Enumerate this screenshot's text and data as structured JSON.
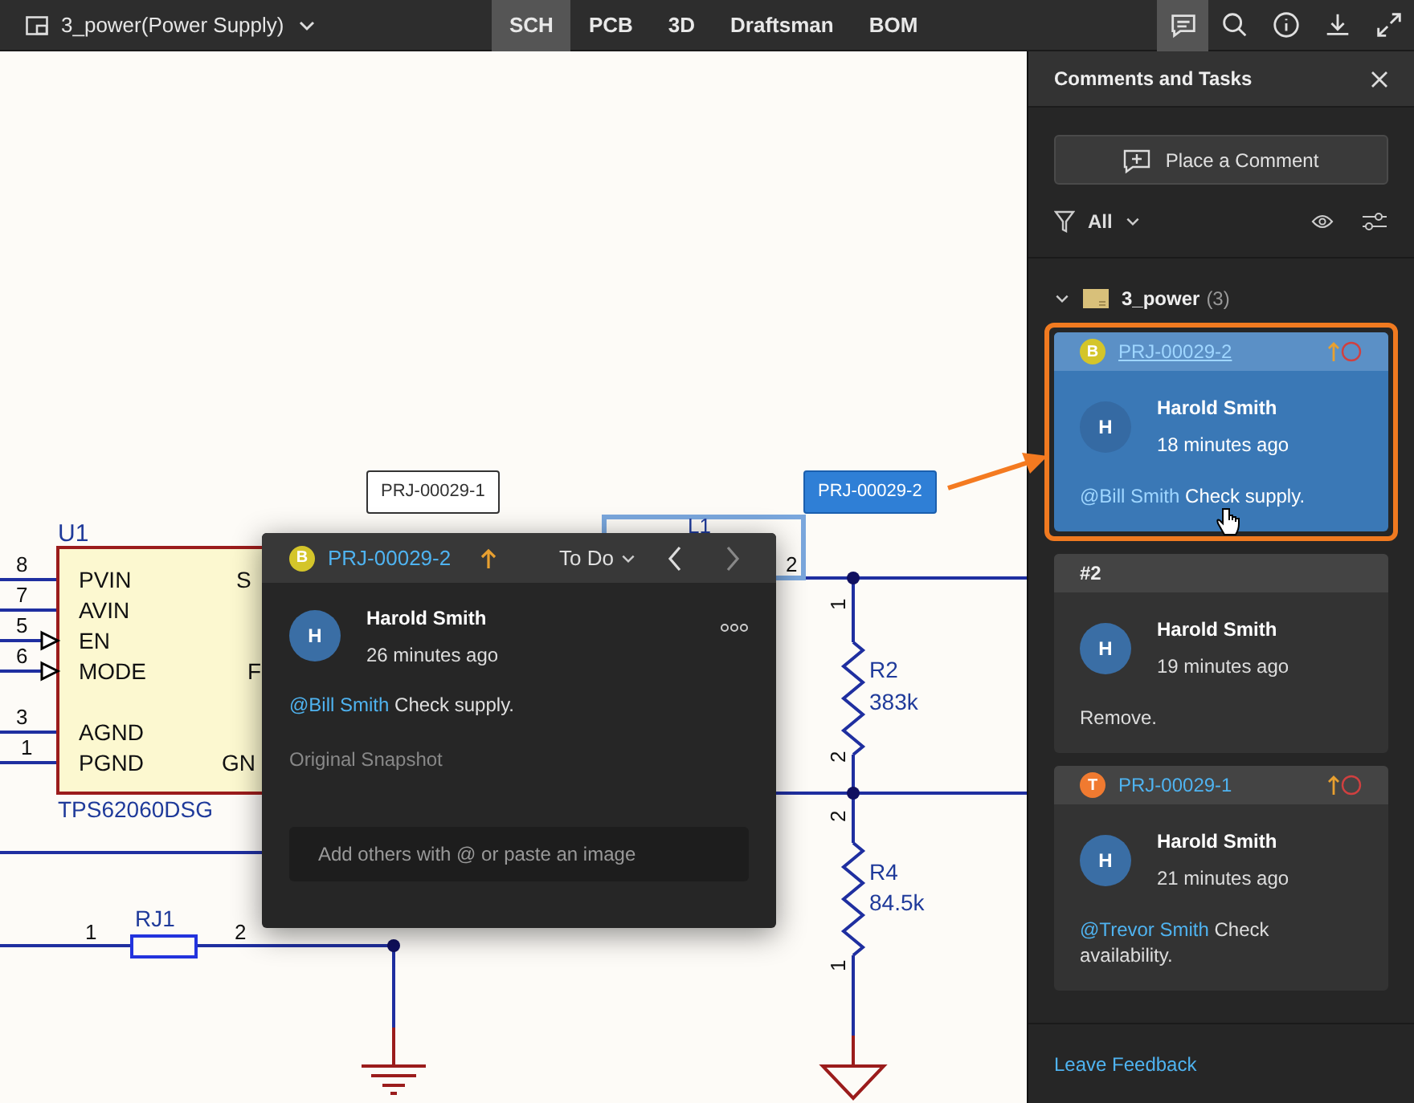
{
  "toolbar": {
    "project_title": "3_power(Power Supply)",
    "tabs": [
      {
        "label": "SCH",
        "selected": true
      },
      {
        "label": "PCB",
        "selected": false
      },
      {
        "label": "3D",
        "selected": false
      },
      {
        "label": "Draftsman",
        "selected": false
      },
      {
        "label": "BOM",
        "selected": false
      }
    ],
    "tool_buttons": [
      {
        "kind": "comments",
        "selected": true
      },
      {
        "kind": "search",
        "selected": false
      },
      {
        "kind": "info",
        "selected": false
      },
      {
        "kind": "download",
        "selected": false
      },
      {
        "kind": "expand",
        "selected": false
      }
    ]
  },
  "schematic": {
    "labels": [
      "U1",
      "8",
      "7",
      "5",
      "6",
      "3",
      "1",
      "PVIN",
      "AVIN",
      "EN",
      "MODE",
      "AGND",
      "PGND",
      "S",
      "F",
      "GN",
      "TPS62060DSG",
      "L1",
      "2",
      "1",
      "R2",
      "383k",
      "2",
      "2",
      "R4",
      "84.5k",
      "1",
      "RJ1",
      "1",
      "2"
    ],
    "comment_tags": [
      {
        "label": "PRJ-00029-1",
        "selected": false
      },
      {
        "label": "PRJ-00029-2",
        "selected": true
      }
    ]
  },
  "popup": {
    "badge": "B",
    "color": "#d4c52a",
    "id": "PRJ-00029-2",
    "status": "To Do",
    "avatar": "H",
    "author": "Harold Smith",
    "time": "26 minutes ago",
    "mention": "@Bill Smith",
    "text": "Check supply.",
    "snapshot_label": "Original Snapshot",
    "reply_placeholder": "Add others with @ or paste an image"
  },
  "panel": {
    "title": "Comments and Tasks",
    "place_button": "Place a Comment",
    "filter": "All",
    "group": {
      "name": "3_power",
      "count": "(3)",
      "expanded": true
    },
    "cards": [
      {
        "kind": "thread",
        "badge": "B",
        "color": "#d4c52a",
        "id": "PRJ-00029-2",
        "selected": true,
        "avatar": "H",
        "author": "Harold Smith",
        "time": "18 minutes ago",
        "mention": "@Bill Smith",
        "text": "Check supply."
      },
      {
        "kind": "reply",
        "label": "#2",
        "selected": false,
        "avatar": "H",
        "author": "Harold Smith",
        "time": "19 minutes ago",
        "text": "Remove."
      },
      {
        "kind": "thread",
        "badge": "T",
        "color": "#f07a30",
        "id": "PRJ-00029-1",
        "selected": false,
        "avatar": "H",
        "author": "Harold Smith",
        "time": "21 minutes ago",
        "mention": "@Trevor Smith",
        "text": "Check availability."
      }
    ],
    "feedback_link": "Leave Feedback"
  }
}
